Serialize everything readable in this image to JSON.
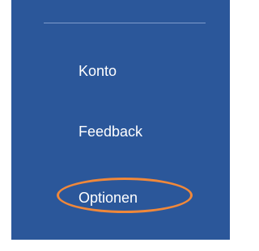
{
  "menu": {
    "items": [
      {
        "label": "Konto"
      },
      {
        "label": "Feedback"
      },
      {
        "label": "Optionen"
      }
    ],
    "highlighted_item": "Optionen"
  },
  "colors": {
    "panel_background": "#2b579a",
    "divider": "#7f9ccc",
    "text": "#ffffff",
    "highlight_ring": "#f0883a",
    "page_background": "#ffffff"
  }
}
